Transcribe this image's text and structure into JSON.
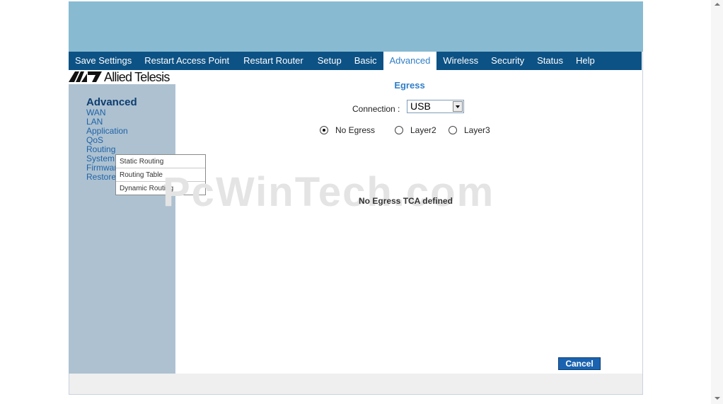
{
  "nav": {
    "items": [
      {
        "label": "Save Settings"
      },
      {
        "label": "Restart Access Point"
      },
      {
        "label": "Restart Router"
      },
      {
        "label": "Setup"
      },
      {
        "label": "Basic"
      },
      {
        "label": "Advanced"
      },
      {
        "label": "Wireless"
      },
      {
        "label": "Security"
      },
      {
        "label": "Status"
      },
      {
        "label": "Help"
      }
    ],
    "active": "Advanced"
  },
  "logo": {
    "text": "Allied Telesis"
  },
  "sidebar": {
    "heading": "Advanced",
    "items": [
      {
        "label": "WAN"
      },
      {
        "label": "LAN"
      },
      {
        "label": "Application"
      },
      {
        "label": "QoS"
      },
      {
        "label": "Routing"
      },
      {
        "label": "System"
      },
      {
        "label": "Firmware"
      },
      {
        "label": "Restore"
      }
    ],
    "submenu": [
      {
        "label": "Static Routing"
      },
      {
        "label": "Routing Table"
      },
      {
        "label": "Dynamic Routing"
      }
    ]
  },
  "main": {
    "title": "Egress",
    "connection_label": "Connection :",
    "connection_value": "USB",
    "radios": [
      {
        "label": "No Egress",
        "checked": true
      },
      {
        "label": "Layer2",
        "checked": false
      },
      {
        "label": "Layer3",
        "checked": false
      }
    ],
    "message": "No Egress TCA defined",
    "cancel_label": "Cancel"
  },
  "watermark": "PcWinTech.com",
  "colors": {
    "banner": "#88bad2",
    "nav_bg": "#0d5285",
    "sidebar_bg": "#adc1d0",
    "accent": "#2f7ec6",
    "button": "#1b63b0"
  }
}
